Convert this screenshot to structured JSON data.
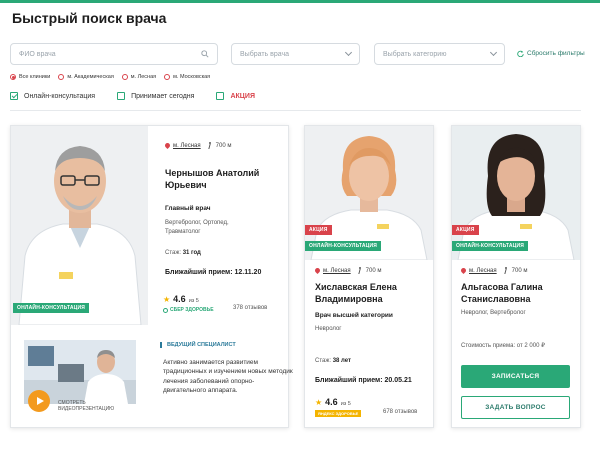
{
  "page": {
    "title": "Быстрый поиск врача"
  },
  "colors": {
    "accent": "#2aa877",
    "alert": "#d9434b",
    "star": "#f4b400",
    "play": "#f39a1e"
  },
  "filters": {
    "doctor_name_placeholder": "ФИО врача",
    "doctor_select_placeholder": "Выбрать врача",
    "category_select_placeholder": "Выбрать категорию",
    "reset_label": "Сбросить фильтры",
    "clinics": [
      {
        "label": "Все клиники",
        "selected": true
      },
      {
        "label": "м. Академическая",
        "selected": false
      },
      {
        "label": "м. Лесная",
        "selected": false
      },
      {
        "label": "м. Московская",
        "selected": false
      }
    ],
    "checks": [
      {
        "label": "Онлайн-консультация",
        "checked": true
      },
      {
        "label": "Принимает сегодня",
        "checked": false
      },
      {
        "label": "АКЦИЯ",
        "checked": false
      }
    ]
  },
  "doctors": [
    {
      "metro": "м. Лесная",
      "distance": "700 м",
      "name_line1": "Чернышов Анатолий",
      "name_line2": "Юрьевич",
      "role": "Главный врач",
      "spec_line1": "Вертебролог, Ортопед,",
      "spec_line2": "Травматолог",
      "experience_label": "Стаж:",
      "experience": "31 год",
      "next_label": "Ближайший прием:",
      "next_date": "12.11.20",
      "rating": "4.6",
      "rating_of": "из 5",
      "reviews": "378 отзывов",
      "sber": "СБЕР ЗДОРОВЬЕ",
      "online_badge": "ОНЛАЙН-КОНСУЛЬТАЦИЯ",
      "leading_label": "ВЕДУЩИЙ СПЕЦИАЛИСТ",
      "desc": "Активно занимается развитием традиционных и изучением новых методик лечения заболеваний опорно-двигательного аппарата.",
      "video_label_line1": "СМОТРЕТЬ",
      "video_label_line2": "ВИДЕОПРЕЗЕНТАЦИЮ"
    },
    {
      "promo_badge": "АКЦИЯ",
      "online_badge": "ОНЛАЙН-КОНСУЛЬТАЦИЯ",
      "metro": "м. Лесная",
      "distance": "700 м",
      "name_line1": "Хиславская Елена",
      "name_line2": "Владимировна",
      "role": "Врач высшей категории",
      "spec": "Невролог",
      "experience_label": "Стаж:",
      "experience": "38 лет",
      "next_label": "Ближайший прием:",
      "next_date": "20.05.21",
      "rating": "4.6",
      "rating_of": "из 5",
      "reviews": "678 отзывов",
      "yandex_tag": "ЯНДЕКС ЗДОРОВЬЕ"
    },
    {
      "promo_badge": "АКЦИЯ",
      "online_badge": "ОНЛАЙН-КОНСУЛЬТАЦИЯ",
      "metro": "м. Лесная",
      "distance": "700 м",
      "name_line1": "Альгасова Галина",
      "name_line2": "Станиславовна",
      "spec": "Невролог, Вертебролог",
      "price_label": "Стоимость приема: от",
      "price": "2 000 ₽",
      "book_button": "ЗАПИСАТЬСЯ",
      "ask_button": "ЗАДАТЬ ВОПРОС"
    }
  ]
}
